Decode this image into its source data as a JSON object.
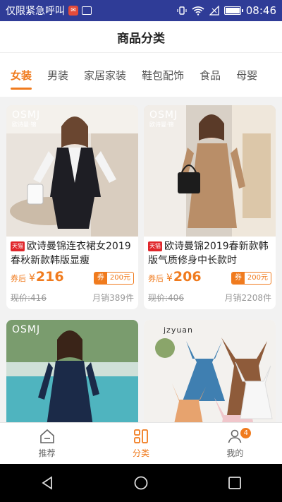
{
  "statusbar": {
    "carrier": "仅限紧急呼叫",
    "time": "08:46"
  },
  "header": {
    "title": "商品分类"
  },
  "tabs": [
    {
      "label": "女装",
      "active": true
    },
    {
      "label": "男装"
    },
    {
      "label": "家居家装"
    },
    {
      "label": "鞋包配饰"
    },
    {
      "label": "食品"
    },
    {
      "label": "母婴"
    }
  ],
  "products": [
    {
      "brand": "OSMJ",
      "brand_sub": "欧诗曼·锦",
      "store_tag": "天猫",
      "title": "欧诗曼锦连衣裙女2019春秋新款韩版显瘦",
      "after_label": "券后",
      "currency": "¥",
      "price": "216",
      "coupon_label": "券",
      "coupon_value": "200元",
      "original_price": "现价:416",
      "sales": "月销389件"
    },
    {
      "brand": "OSMJ",
      "brand_sub": "欧诗曼·锦",
      "store_tag": "天猫",
      "title": "欧诗曼锦2019春新款韩版气质修身中长款时",
      "after_label": "券后",
      "currency": "¥",
      "price": "206",
      "coupon_label": "券",
      "coupon_value": "200元",
      "original_price": "现价:406",
      "sales": "月销2208件"
    },
    {
      "brand": "OSMJ"
    },
    {
      "brand": "jzyuan"
    }
  ],
  "bottom_nav": [
    {
      "label": "推荐",
      "icon": "home-icon"
    },
    {
      "label": "分类",
      "icon": "category-icon",
      "active": true
    },
    {
      "label": "我的",
      "icon": "user-icon",
      "badge": "4"
    }
  ],
  "colors": {
    "accent": "#f07b1e",
    "statusbar": "#2f3c97",
    "tmall": "#e0262b"
  }
}
